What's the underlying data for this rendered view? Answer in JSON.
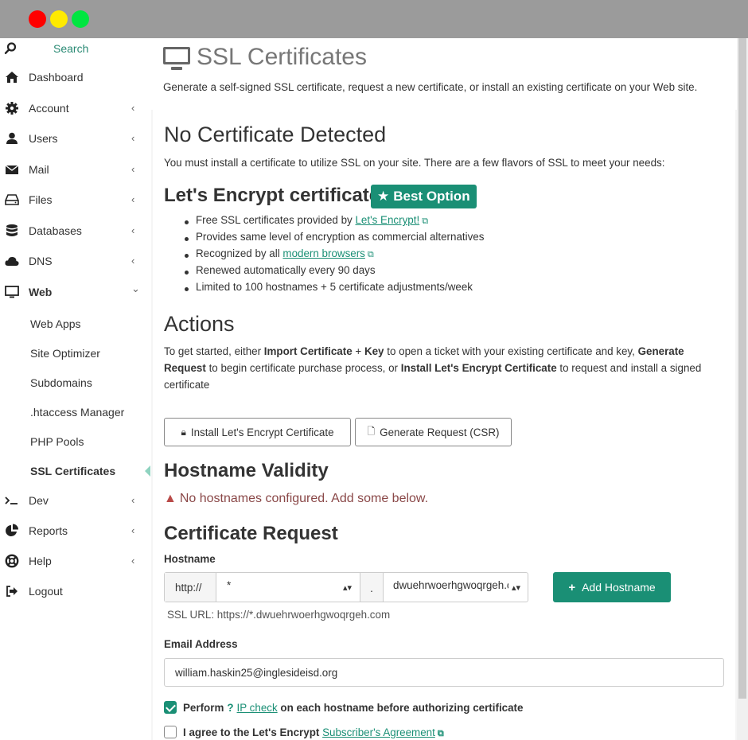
{
  "window": {
    "title": "SSL Certificates"
  },
  "sidebar": {
    "search_label": "Search",
    "items": [
      {
        "label": "Dashboard",
        "icon": "home-icon",
        "has_children": false
      },
      {
        "label": "Account",
        "icon": "gear-icon",
        "has_children": true
      },
      {
        "label": "Users",
        "icon": "user-icon",
        "has_children": true
      },
      {
        "label": "Mail",
        "icon": "envelope-icon",
        "has_children": true
      },
      {
        "label": "Files",
        "icon": "drive-icon",
        "has_children": true
      },
      {
        "label": "Databases",
        "icon": "database-icon",
        "has_children": true
      },
      {
        "label": "DNS",
        "icon": "cloud-icon",
        "has_children": true
      },
      {
        "label": "Web",
        "icon": "monitor-icon",
        "has_children": true,
        "expanded": true
      }
    ],
    "web_subitems": [
      "Web Apps",
      "Site Optimizer",
      "Subdomains",
      ".htaccess Manager",
      "PHP Pools",
      "SSL Certificates"
    ],
    "current_subitem": "SSL Certificates",
    "items_after": [
      {
        "label": "Dev",
        "icon": "terminal-icon",
        "has_children": true
      },
      {
        "label": "Reports",
        "icon": "pie-chart-icon",
        "has_children": true
      },
      {
        "label": "Help",
        "icon": "lifebuoy-icon",
        "has_children": true
      },
      {
        "label": "Logout",
        "icon": "logout-icon",
        "has_children": false
      }
    ],
    "chevron_left": "‹",
    "chevron_down": "⌄"
  },
  "page": {
    "title": "SSL Certificates",
    "description": "Generate a self-signed SSL certificate, request a new certificate, or install an existing certificate on your Web site."
  },
  "no_cert": {
    "heading": "No Certificate Detected",
    "text": "You must install a certificate to utilize SSL on your site. There are a few flavors of SSL to meet your needs:"
  },
  "letsencrypt": {
    "heading": "Let's Encrypt certificate",
    "badge": "Best Option",
    "bullets": [
      {
        "pre": "Free SSL certificates provided by ",
        "link": "Let's Encrypt!",
        "post": ""
      },
      {
        "pre": "Provides same level of encryption as commercial alternatives",
        "link": "",
        "post": ""
      },
      {
        "pre": "Recognized by all ",
        "link": "modern browsers",
        "post": ""
      },
      {
        "pre": "Renewed automatically every 90 days",
        "link": "",
        "post": ""
      },
      {
        "pre": "Limited to 100 hostnames + 5 certificate adjustments/week",
        "link": "",
        "post": ""
      }
    ]
  },
  "actions": {
    "heading": "Actions",
    "p1": "To get started, either ",
    "b1": "Import Certificate",
    "p2": " + ",
    "b2": "Key",
    "p3": " to open a ticket with your existing certificate and key, ",
    "b3": "Generate Request",
    "p4": " to begin certificate purchase process, or ",
    "b4": "Install Let's Encrypt Certificate",
    "p5": " to request and install a signed certificate",
    "install_button": "Install Let's Encrypt Certificate",
    "generate_button": "Generate Request (CSR)"
  },
  "validity": {
    "heading": "Hostname Validity",
    "warning": "No hostnames configured. Add some below."
  },
  "request": {
    "heading": "Certificate Request",
    "hostname_label": "Hostname",
    "protocol": "http://",
    "subdomain": "*",
    "dot": ".",
    "domain": "dwuehrwoerhgwoqrgeh.com",
    "add_button": "Add Hostname",
    "ssl_url": "SSL URL: https://*.dwuehrwoerhgwoqrgeh.com",
    "email_label": "Email Address",
    "email_value": "william.haskin25@inglesideisd.org",
    "perform_pre": "Perform",
    "perform_link": "IP check",
    "perform_post": " on each hostname before authorizing certificate",
    "perform_checked": true,
    "agree_pre": "I agree to the Let's Encrypt ",
    "agree_link": "Subscriber's Agreement",
    "agree_checked": false
  },
  "colors": {
    "accent": "#1a8f75",
    "warning": "#8a4848",
    "titlebar": "#9b9b9b"
  }
}
